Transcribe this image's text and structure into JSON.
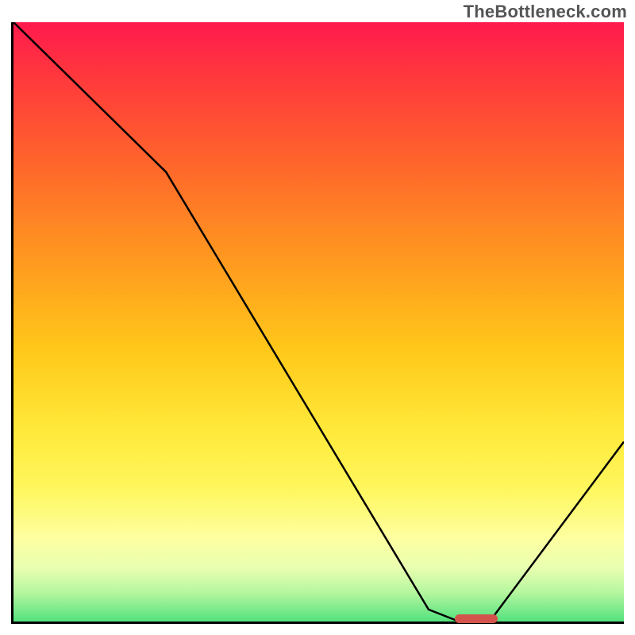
{
  "watermark": "TheBottleneck.com",
  "chart_data": {
    "type": "line",
    "title": "",
    "xlabel": "",
    "ylabel": "",
    "xlim": [
      0,
      100
    ],
    "ylim": [
      0,
      100
    ],
    "grid": false,
    "series": [
      {
        "name": "curve",
        "x": [
          0,
          25,
          68,
          73,
          78,
          100
        ],
        "y": [
          100,
          75,
          2,
          0,
          0,
          30
        ],
        "color": "#000000"
      }
    ],
    "background_gradient": {
      "orientation": "vertical",
      "stops": [
        {
          "pos": 0.0,
          "color": "#ff1a4d"
        },
        {
          "pos": 0.25,
          "color": "#ff6a2a"
        },
        {
          "pos": 0.55,
          "color": "#ffc91a"
        },
        {
          "pos": 0.78,
          "color": "#fff75e"
        },
        {
          "pos": 0.95,
          "color": "#b8f7a0"
        },
        {
          "pos": 1.0,
          "color": "#53e27e"
        }
      ]
    },
    "annotations": [
      {
        "name": "sweet-spot-marker",
        "shape": "capsule",
        "x_center": 75.5,
        "y_center": 0.5,
        "width": 7,
        "height": 1.5,
        "color": "#d2544d"
      }
    ]
  }
}
